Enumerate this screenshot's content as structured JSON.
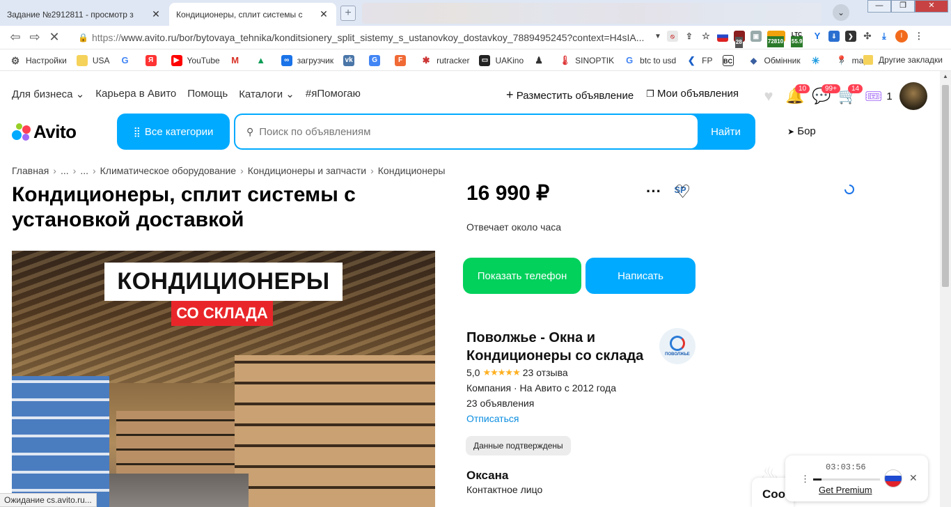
{
  "browser": {
    "tabs": [
      {
        "favicon": "SP",
        "title": "Задание №2912811 - просмотр з"
      },
      {
        "favicon": "loading",
        "title": "Кондиционеры, сплит системы с"
      }
    ],
    "url_scheme": "https://",
    "url_rest": "www.avito.ru/bor/bytovaya_tehnika/konditsionery_split_sistemy_s_ustanovkoy_dostavkoy_7889495245?context=H4sIA...",
    "extension_texts": [
      "28",
      "72810",
      "LTC",
      "55.9"
    ],
    "profile_initial": "I",
    "bookmarks": [
      "Настройки",
      "USA",
      "YouTube",
      "загрузчик",
      "rutracker",
      "UAKino",
      "SINOPTIK",
      "btc to usd",
      "FP",
      "Обмінник",
      "maps"
    ],
    "bookmarks_more": "»",
    "other_bookmarks": "Другие закладки",
    "status_text": "Ожидание cs.avito.ru..."
  },
  "header": {
    "nav": [
      "Для бизнеса",
      "Карьера в Авито",
      "Помощь",
      "Каталоги",
      "#яПомогаю"
    ],
    "post_ad": "Разместить объявление",
    "my_ads": "Мои объявления",
    "badges": {
      "notifications": "10",
      "messages": "99+",
      "cart": "14"
    },
    "bonus_count": "1",
    "logo": "Avito",
    "all_categories": "Все категории",
    "search_placeholder": "Поиск по объявлениям",
    "search_button": "Найти",
    "location": "Бор"
  },
  "breadcrumbs": [
    "Главная",
    "...",
    "...",
    "Климатическое оборудование",
    "Кондиционеры и запчасти",
    "Кондиционеры"
  ],
  "listing": {
    "title": "Кондиционеры, сплит системы с установкой доставкой",
    "photo_text_1": "КОНДИЦИОНЕРЫ",
    "photo_text_2": "СО СКЛАДА",
    "price": "16 990 ₽",
    "reply_time": "Отвечает около часа",
    "show_phone": "Показать телефон",
    "write": "Написать"
  },
  "seller": {
    "name": "Поволжье - Окна и Кондиционеры со склада",
    "logo_text": "ПОВОЛЖЬЕ",
    "rating": "5,0",
    "stars": 5,
    "reviews": "23 отзыва",
    "type": "Компания · На Авито с 2012 года",
    "ads_count": "23 объявления",
    "unsubscribe": "Отписаться",
    "verified": "Данные подтверждены",
    "contact_name": "Оксана",
    "contact_role": "Контактное лицо"
  },
  "overlay": {
    "player_time": "03:03:56",
    "player_progress": 0.12,
    "premium": "Get Premium",
    "chat_stub": "Соо"
  },
  "colors": {
    "accent": "#00aaff",
    "green": "#02d15c",
    "badge": "#ff4053",
    "link": "#0a8de0"
  }
}
